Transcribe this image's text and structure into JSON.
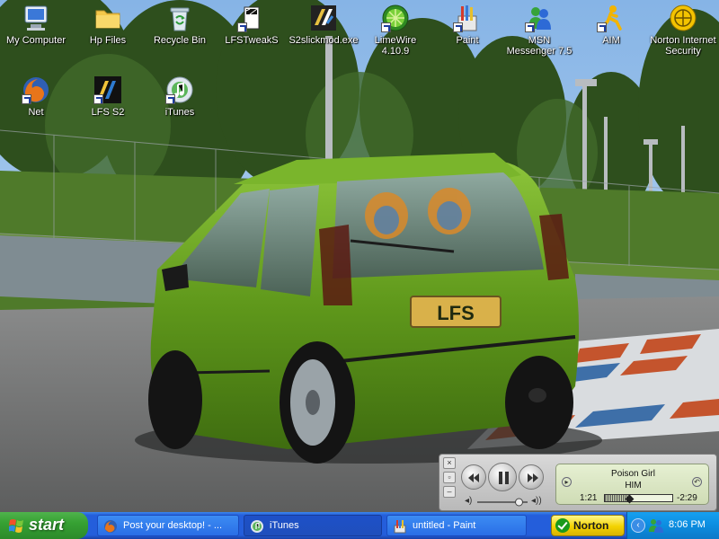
{
  "desktop": {
    "icons": [
      {
        "label": "My Computer",
        "icon": "my-computer-icon"
      },
      {
        "label": "Hp Files",
        "icon": "folder-icon"
      },
      {
        "label": "Recycle Bin",
        "icon": "recycle-bin-icon"
      },
      {
        "label": "LFSTweakS",
        "icon": "lfstweaks-icon"
      },
      {
        "label": "S2slickmod.exe",
        "icon": "s2slickmod-icon"
      },
      {
        "label": "LimeWire 4.10.9",
        "icon": "limewire-icon"
      },
      {
        "label": "Paint",
        "icon": "paint-icon"
      },
      {
        "label": "MSN Messenger 7.5",
        "icon": "msn-messenger-icon"
      },
      {
        "label": "AIM",
        "icon": "aim-icon"
      },
      {
        "label": "Norton Internet Security",
        "icon": "norton-internet-security-icon"
      },
      {
        "label": "Net",
        "icon": "firefox-icon"
      },
      {
        "label": "LFS S2",
        "icon": "lfs-s2-icon"
      },
      {
        "label": "iTunes",
        "icon": "itunes-icon"
      }
    ],
    "wallpaper": {
      "plate_text": "LFS",
      "car_color": "#6aa31f",
      "sky_color": "#9fc3e8",
      "grass_color": "#4f7a2a"
    }
  },
  "itunes_mini_player": {
    "song_title": "Poison Girl",
    "artist": "HIM",
    "elapsed": "1:21",
    "remaining": "-2:29",
    "progress_fraction": 0.36,
    "volume_fraction": 0.85,
    "buttons": {
      "previous": "previous-icon",
      "pause": "pause-icon",
      "next": "next-icon"
    }
  },
  "taskbar": {
    "start_label": "start",
    "tasks": [
      {
        "label": "Post your desktop! - ...",
        "icon": "firefox-icon",
        "active": false
      },
      {
        "label": "iTunes",
        "icon": "itunes-icon",
        "active": true
      },
      {
        "label": "untitled - Paint",
        "icon": "paint-icon",
        "active": false
      }
    ],
    "norton_label": "Norton",
    "clock": "8:06 PM",
    "colors": {
      "taskbar": "#245edb",
      "start": "#36a133",
      "tray": "#0c8de0"
    }
  }
}
